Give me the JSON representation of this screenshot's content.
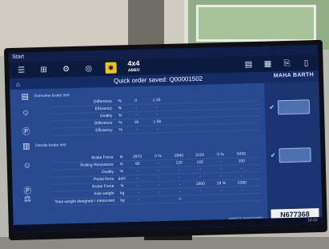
{
  "app": {
    "title": "Start"
  },
  "header": {
    "title": "Quick order saved: Q00001502",
    "brand": "MAHA BARTH",
    "mode_label": "4x4",
    "mode_sub": "ABBO"
  },
  "overview": {
    "section_title": "Overview brake test",
    "rows": [
      {
        "label": "Difference",
        "unit": "%",
        "c1": "0",
        "c2": "≤ 25"
      },
      {
        "label": "Efficiency",
        "unit": "%",
        "c1": "-",
        "c2": "-"
      },
      {
        "label": "Ovality",
        "unit": "%",
        "c1": "-",
        "c2": "-"
      },
      {
        "label": "Difference",
        "unit": "%",
        "c1": "19",
        "c2": "≤ 56"
      },
      {
        "label": "Efficiency",
        "unit": "%",
        "c1": "-",
        "c2": "-"
      }
    ]
  },
  "details": {
    "section_title": "Details brake test",
    "rows": [
      {
        "label": "Brake Force",
        "unit": "N",
        "vals": [
          "2970",
          "0 %",
          "2940",
          "3120",
          "5 %",
          "5430"
        ]
      },
      {
        "label": "Rolling Resistance",
        "unit": "N",
        "vals": [
          "90",
          "-",
          "120",
          "120",
          "-",
          "150"
        ]
      },
      {
        "label": "Ovality",
        "unit": "%",
        "vals": [
          "-",
          "-",
          "-",
          "-",
          "-",
          "-"
        ]
      },
      {
        "label": "Pedal force",
        "unit": "daN",
        "vals": [
          "-",
          "-",
          "-",
          "-",
          "-",
          "-"
        ]
      },
      {
        "label": "Brake Force",
        "unit": "N",
        "vals": [
          "-",
          "-",
          "-",
          "2900",
          "19 %",
          "2380"
        ]
      },
      {
        "label": "Axle weight",
        "unit": "kg",
        "vals": [
          "-",
          "-",
          "-",
          "-",
          "-",
          "-"
        ]
      },
      {
        "label": "Total weight designed / measured",
        "unit": "kg",
        "vals": [
          "-",
          "",
          "-/-",
          "",
          "",
          ""
        ]
      }
    ]
  },
  "plate": {
    "number": "N677368"
  },
  "footer": {
    "note": "signed by tested system"
  },
  "taskbar": {
    "time": "16:02"
  }
}
